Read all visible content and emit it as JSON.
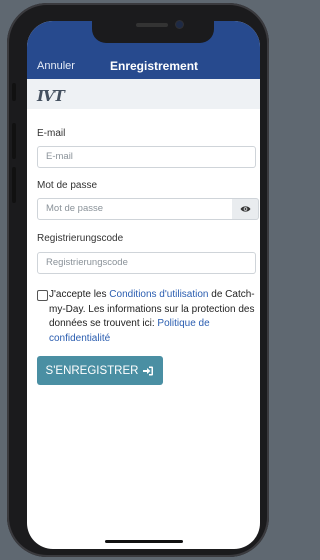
{
  "header": {
    "cancel_label": "Annuler",
    "title": "Enregistrement"
  },
  "logo_text": "IVT",
  "form": {
    "email": {
      "label": "E-mail",
      "placeholder": "E-mail"
    },
    "password": {
      "label": "Mot de passe",
      "placeholder": "Mot de passe"
    },
    "registration_code": {
      "label": "Registrierungscode",
      "placeholder": "Registrierungscode"
    },
    "consent": {
      "text_1": "J'accepte les ",
      "terms_link": "Conditions d'utilisation",
      "text_2": " de Catch-my-Day. Les informations sur la protection des données se trouvent ici: ",
      "privacy_link": "Politique de confidentialité"
    },
    "submit_label": "S'ENREGISTRER"
  },
  "icons": {
    "password_toggle": "eye-icon",
    "submit": "sign-in-icon"
  },
  "colors": {
    "header_bg": "#274a8e",
    "submit_bg": "#4a8fa3",
    "link": "#2a5db0"
  }
}
